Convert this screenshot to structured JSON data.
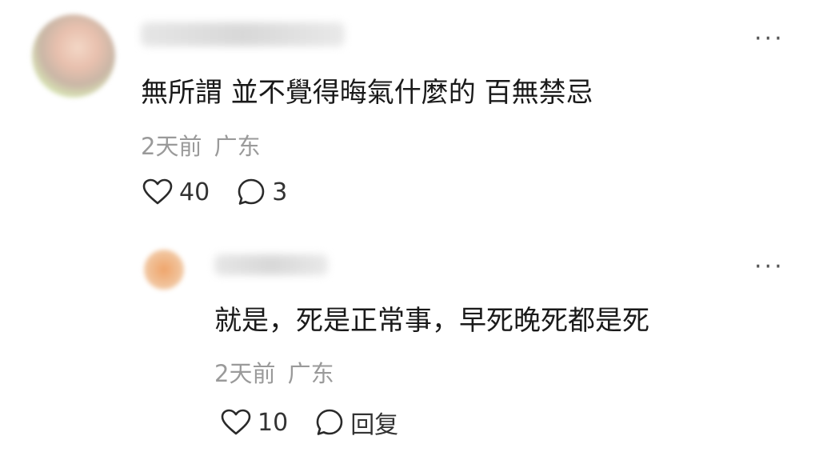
{
  "main_comment": {
    "text": "無所謂 並不覺得晦氣什麼的 百無禁忌",
    "time": "2天前",
    "location": "广东",
    "like_count": "40",
    "reply_count": "3"
  },
  "reply": {
    "text": "就是，死是正常事，早死晚死都是死",
    "time": "2天前",
    "location": "广东",
    "like_count": "10",
    "reply_label": "回复"
  },
  "icons": {
    "like": "heart-outline-icon",
    "comment": "speech-bubble-icon",
    "more": "more-dots-icon"
  },
  "colors": {
    "meta_gray": "#9a9a9a",
    "text": "#1a1a1a"
  }
}
